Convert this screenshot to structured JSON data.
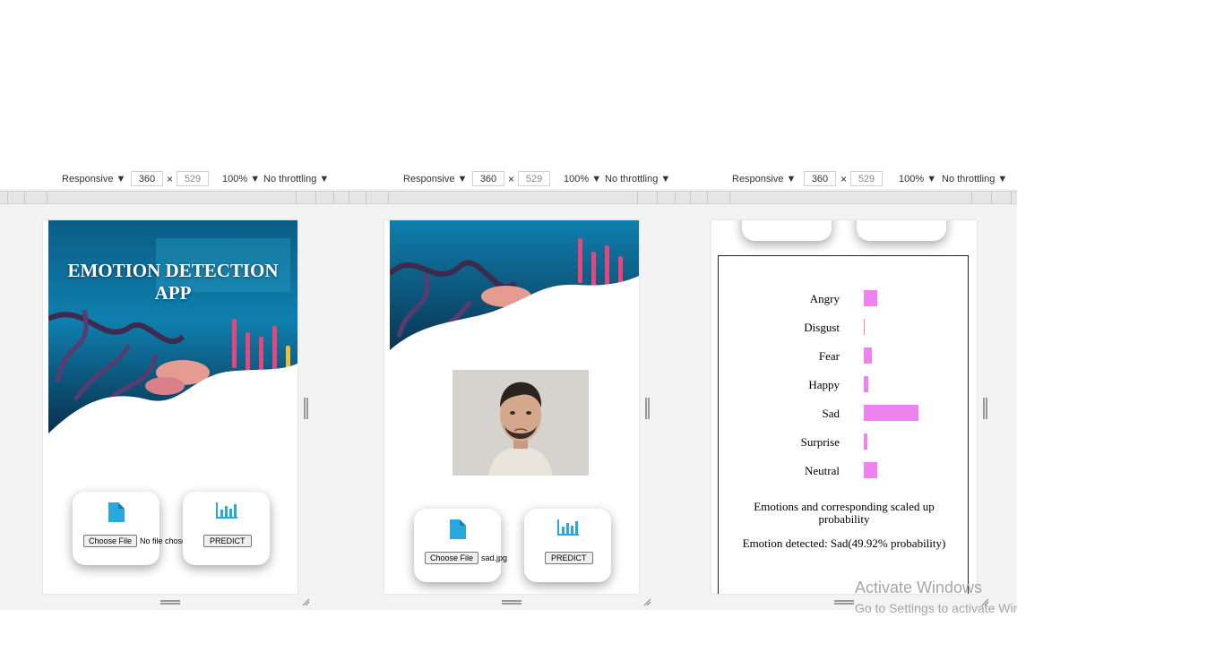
{
  "toolbar": {
    "device_mode": "Responsive",
    "width": "360",
    "height": "529",
    "x_sep": "×",
    "zoom": "100%",
    "throttling": "No throttling",
    "rotate_icon": "rotate-icon"
  },
  "app": {
    "title": "EMOTION DETECTION APP",
    "choose_file_label": "Choose File",
    "no_file": "No file chosen",
    "selected_file": "sad.jpg",
    "predict_label": "PREDICT"
  },
  "results": {
    "emotions": [
      {
        "label": "Angry",
        "value": 0.12
      },
      {
        "label": "Disgust",
        "value": 0.01
      },
      {
        "label": "Fear",
        "value": 0.07
      },
      {
        "label": "Happy",
        "value": 0.04
      },
      {
        "label": "Sad",
        "value": 0.4992
      },
      {
        "label": "Surprise",
        "value": 0.03
      },
      {
        "label": "Neutral",
        "value": 0.12
      }
    ],
    "caption": "Emotions and corresponding scaled up probability",
    "detected": "Emotion detected: Sad(49.92% probability)"
  },
  "watermark": {
    "line1": "Activate Windows",
    "line2": "Go to Settings to activate Windows."
  },
  "colors": {
    "bar": "#ee82ee",
    "icon": "#29a7df"
  }
}
